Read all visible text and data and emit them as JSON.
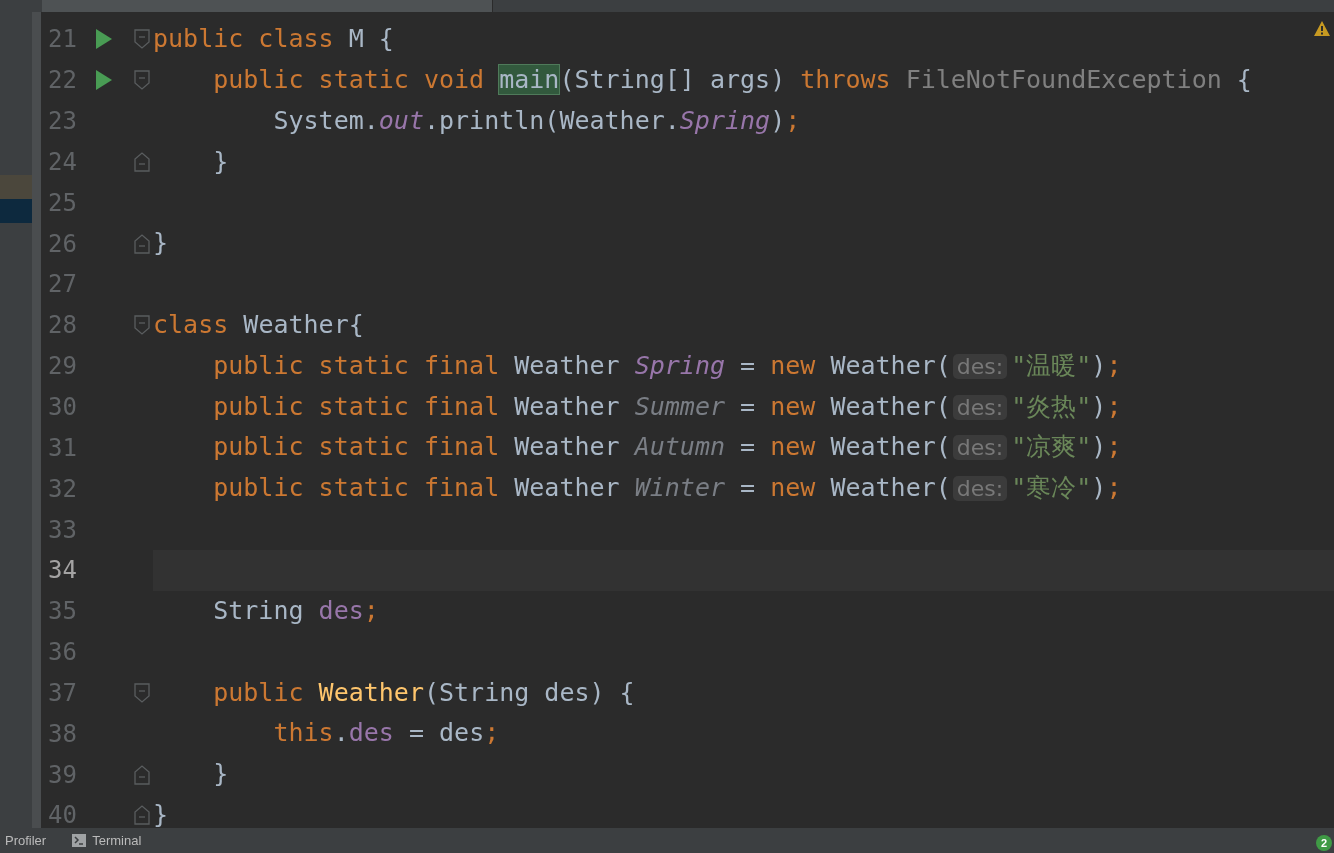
{
  "editor": {
    "lines": [
      {
        "number": "21",
        "current": false,
        "run_icon": true,
        "fold_start": true,
        "fold_end": false,
        "tokens": [
          {
            "kind": "keyword",
            "text": "public class "
          },
          {
            "kind": "plain",
            "text": "M {"
          }
        ]
      },
      {
        "number": "22",
        "current": false,
        "run_icon": true,
        "fold_start": true,
        "fold_end": false,
        "tokens": [
          {
            "kind": "keyword",
            "text": "    public static void "
          },
          {
            "kind": "usage",
            "text": "main"
          },
          {
            "kind": "plain",
            "text": "(String[] args) "
          },
          {
            "kind": "keyword",
            "text": "throws "
          },
          {
            "kind": "unused",
            "text": "FileNotFoundException"
          },
          {
            "kind": "plain",
            "text": " {"
          }
        ]
      },
      {
        "number": "23",
        "current": false,
        "run_icon": false,
        "fold_start": false,
        "fold_end": false,
        "tokens": [
          {
            "kind": "plain",
            "text": "        System."
          },
          {
            "kind": "static_field",
            "text": "out"
          },
          {
            "kind": "plain",
            "text": ".println(Weather."
          },
          {
            "kind": "static_field",
            "text": "Spring"
          },
          {
            "kind": "plain",
            "text": ")"
          },
          {
            "kind": "keyword",
            "text": ";"
          }
        ]
      },
      {
        "number": "24",
        "current": false,
        "run_icon": false,
        "fold_start": false,
        "fold_end": true,
        "tokens": [
          {
            "kind": "plain",
            "text": "    }"
          }
        ]
      },
      {
        "number": "25",
        "current": false,
        "run_icon": false,
        "fold_start": false,
        "fold_end": false
      },
      {
        "number": "26",
        "current": false,
        "run_icon": false,
        "fold_start": false,
        "fold_end": true,
        "tokens": [
          {
            "kind": "plain",
            "text": "}"
          }
        ]
      },
      {
        "number": "27",
        "current": false,
        "run_icon": false,
        "fold_start": false,
        "fold_end": false
      },
      {
        "number": "28",
        "current": false,
        "run_icon": false,
        "fold_start": true,
        "fold_end": false,
        "tokens": [
          {
            "kind": "keyword",
            "text": "class "
          },
          {
            "kind": "plain",
            "text": "Weather{"
          }
        ]
      },
      {
        "number": "29",
        "current": false,
        "run_icon": false,
        "fold_start": false,
        "fold_end": false,
        "tokens": [
          {
            "kind": "keyword",
            "text": "    public static final "
          },
          {
            "kind": "plain",
            "text": "Weather "
          },
          {
            "kind": "static_field",
            "text": "Spring"
          },
          {
            "kind": "plain",
            "text": " = "
          },
          {
            "kind": "keyword",
            "text": "new "
          },
          {
            "kind": "plain",
            "text": "Weather("
          },
          {
            "kind": "hint",
            "text": "des:"
          },
          {
            "kind": "string",
            "text": "\"温暖\""
          },
          {
            "kind": "plain",
            "text": ")"
          },
          {
            "kind": "keyword",
            "text": ";"
          }
        ]
      },
      {
        "number": "30",
        "current": false,
        "run_icon": false,
        "fold_start": false,
        "fold_end": false,
        "tokens": [
          {
            "kind": "keyword",
            "text": "    public static final "
          },
          {
            "kind": "plain",
            "text": "Weather "
          },
          {
            "kind": "unused_static",
            "text": "Summer"
          },
          {
            "kind": "plain",
            "text": " = "
          },
          {
            "kind": "keyword",
            "text": "new "
          },
          {
            "kind": "plain",
            "text": "Weather("
          },
          {
            "kind": "hint",
            "text": "des:"
          },
          {
            "kind": "string",
            "text": "\"炎热\""
          },
          {
            "kind": "plain",
            "text": ")"
          },
          {
            "kind": "keyword",
            "text": ";"
          }
        ]
      },
      {
        "number": "31",
        "current": false,
        "run_icon": false,
        "fold_start": false,
        "fold_end": false,
        "tokens": [
          {
            "kind": "keyword",
            "text": "    public static final "
          },
          {
            "kind": "plain",
            "text": "Weather "
          },
          {
            "kind": "unused_static",
            "text": "Autumn"
          },
          {
            "kind": "plain",
            "text": " = "
          },
          {
            "kind": "keyword",
            "text": "new "
          },
          {
            "kind": "plain",
            "text": "Weather("
          },
          {
            "kind": "hint",
            "text": "des:"
          },
          {
            "kind": "string",
            "text": "\"凉爽\""
          },
          {
            "kind": "plain",
            "text": ")"
          },
          {
            "kind": "keyword",
            "text": ";"
          }
        ]
      },
      {
        "number": "32",
        "current": false,
        "run_icon": false,
        "fold_start": false,
        "fold_end": false,
        "tokens": [
          {
            "kind": "keyword",
            "text": "    public static final "
          },
          {
            "kind": "plain",
            "text": "Weather "
          },
          {
            "kind": "unused_static",
            "text": "Winter"
          },
          {
            "kind": "plain",
            "text": " = "
          },
          {
            "kind": "keyword",
            "text": "new "
          },
          {
            "kind": "plain",
            "text": "Weather("
          },
          {
            "kind": "hint",
            "text": "des:"
          },
          {
            "kind": "string",
            "text": "\"寒冷\""
          },
          {
            "kind": "plain",
            "text": ")"
          },
          {
            "kind": "keyword",
            "text": ";"
          }
        ]
      },
      {
        "number": "33",
        "current": false,
        "run_icon": false,
        "fold_start": false,
        "fold_end": false
      },
      {
        "number": "34",
        "current": true,
        "run_icon": false,
        "fold_start": false,
        "fold_end": false
      },
      {
        "number": "35",
        "current": false,
        "run_icon": false,
        "fold_start": false,
        "fold_end": false,
        "tokens": [
          {
            "kind": "plain",
            "text": "    String "
          },
          {
            "kind": "field",
            "text": "des"
          },
          {
            "kind": "keyword",
            "text": ";"
          }
        ]
      },
      {
        "number": "36",
        "current": false,
        "run_icon": false,
        "fold_start": false,
        "fold_end": false
      },
      {
        "number": "37",
        "current": false,
        "run_icon": false,
        "fold_start": true,
        "fold_end": false,
        "tokens": [
          {
            "kind": "keyword",
            "text": "    public "
          },
          {
            "kind": "method_decl",
            "text": "Weather"
          },
          {
            "kind": "plain",
            "text": "(String des) {"
          }
        ]
      },
      {
        "number": "38",
        "current": false,
        "run_icon": false,
        "fold_start": false,
        "fold_end": false,
        "tokens": [
          {
            "kind": "keyword",
            "text": "        this"
          },
          {
            "kind": "plain",
            "text": "."
          },
          {
            "kind": "field",
            "text": "des"
          },
          {
            "kind": "plain",
            "text": " = des"
          },
          {
            "kind": "keyword",
            "text": ";"
          }
        ]
      },
      {
        "number": "39",
        "current": false,
        "run_icon": false,
        "fold_start": false,
        "fold_end": true,
        "tokens": [
          {
            "kind": "plain",
            "text": "    }"
          }
        ]
      },
      {
        "number": "40",
        "current": false,
        "run_icon": false,
        "fold_start": false,
        "fold_end": true,
        "tokens": [
          {
            "kind": "plain",
            "text": "}"
          }
        ]
      }
    ]
  },
  "status_bar": {
    "tabs": [
      {
        "label": "Profiler",
        "icon": false
      },
      {
        "label": "Terminal",
        "icon": true
      }
    ],
    "notification_count": "2"
  }
}
